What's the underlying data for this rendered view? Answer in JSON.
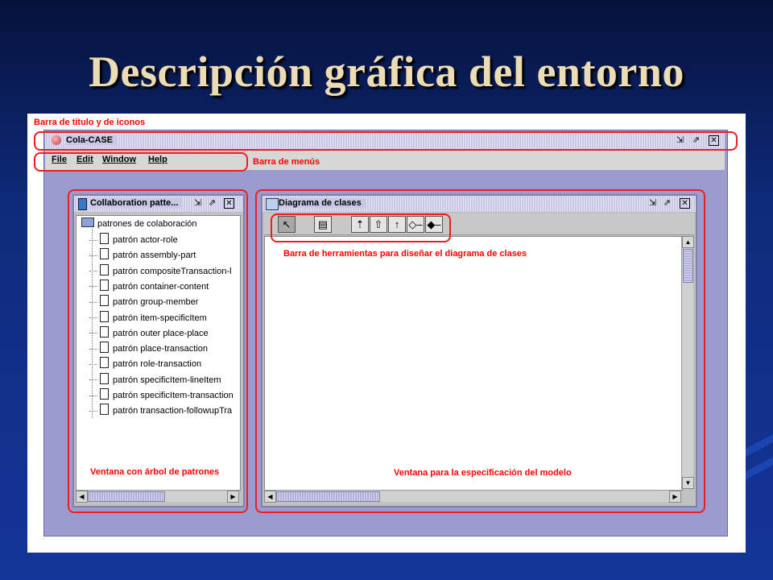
{
  "slide": {
    "title": "Descripción gráfica del entorno"
  },
  "app": {
    "window_title": "Cola-CASE",
    "menu": [
      "File",
      "Edit",
      "Window",
      "Help"
    ]
  },
  "annotations": {
    "titlebar": "Barra de título y de iconos",
    "menubar": "Barra de menús",
    "toolbar": "Barra de herramientas para diseñar el diagrama de clases",
    "tree_window": "Ventana con árbol de patrones",
    "model_window": "Ventana para la especificación del modelo"
  },
  "patterns_window": {
    "title": "Collaboration patte...",
    "root": "patrones de colaboración",
    "items": [
      "patrón actor-role",
      "patrón assembly-part",
      "patrón compositeTransaction-l",
      "patrón container-content",
      "patrón group-member",
      "patrón item-specificItem",
      "patrón outer place-place",
      "patrón place-transaction",
      "patrón role-transaction",
      "patrón specificItem-lineItem",
      "patrón specificItem-transaction",
      "patrón transaction-followupTra"
    ]
  },
  "diagram_window": {
    "title": "Diagrama de clases",
    "tools": [
      "select-arrow-icon",
      "class-icon",
      "dependency-icon",
      "inheritance-icon",
      "association-icon",
      "aggregation-icon",
      "composition-icon"
    ]
  },
  "colors": {
    "annotation": "#ff0000",
    "highlight": "#ee1c24",
    "title_text": "#ecdcb4",
    "desktop": "#9b9bd0"
  }
}
